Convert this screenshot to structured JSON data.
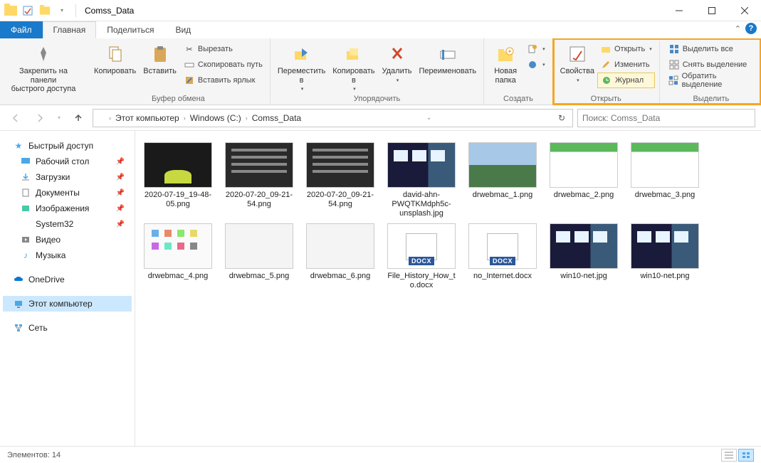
{
  "title": "Comss_Data",
  "tabs": {
    "file": "Файл",
    "home": "Главная",
    "share": "Поделиться",
    "view": "Вид"
  },
  "ribbon": {
    "pin": "Закрепить на панели\nбыстрого доступа",
    "copy": "Копировать",
    "paste": "Вставить",
    "cut": "Вырезать",
    "copy_path": "Скопировать путь",
    "paste_shortcut": "Вставить ярлык",
    "group_clipboard": "Буфер обмена",
    "move_to": "Переместить\nв",
    "copy_to": "Копировать\nв",
    "delete": "Удалить",
    "rename": "Переименовать",
    "group_organize": "Упорядочить",
    "new_folder": "Новая\nпапка",
    "group_new": "Создать",
    "properties": "Свойства",
    "open": "Открыть",
    "edit": "Изменить",
    "history": "Журнал",
    "group_open": "Открыть",
    "select_all": "Выделить все",
    "select_none": "Снять выделение",
    "invert": "Обратить выделение",
    "group_select": "Выделить"
  },
  "breadcrumb": {
    "pc": "Этот компьютер",
    "drive": "Windows (C:)",
    "folder": "Comss_Data"
  },
  "search": {
    "placeholder": "Поиск: Comss_Data"
  },
  "sidebar": {
    "quick": "Быстрый доступ",
    "desktop": "Рабочий стол",
    "downloads": "Загрузки",
    "documents": "Документы",
    "pictures": "Изображения",
    "system32": "System32",
    "videos": "Видео",
    "music": "Музыка",
    "onedrive": "OneDrive",
    "this_pc": "Этот компьютер",
    "network": "Сеть"
  },
  "files": [
    {
      "name": "2020-07-19_19-48-05.png",
      "thumb": "racing"
    },
    {
      "name": "2020-07-20_09-21-54.png",
      "thumb": "darklist"
    },
    {
      "name": "2020-07-20_09-21-54.png",
      "thumb": "darklist"
    },
    {
      "name": "david-ahn-PWQTKMdph5c-unsplash.jpg",
      "thumb": "dark-room"
    },
    {
      "name": "drwebmac_1.png",
      "thumb": "landscape"
    },
    {
      "name": "drwebmac_2.png",
      "thumb": "green"
    },
    {
      "name": "drwebmac_3.png",
      "thumb": "green"
    },
    {
      "name": "drwebmac_4.png",
      "thumb": "icons-grid"
    },
    {
      "name": "drwebmac_5.png",
      "thumb": "white"
    },
    {
      "name": "drwebmac_6.png",
      "thumb": "white"
    },
    {
      "name": "File_History_How_to.docx",
      "thumb": "docx"
    },
    {
      "name": "no_Internet.docx",
      "thumb": "docx"
    },
    {
      "name": "win10-net.jpg",
      "thumb": "dark-room"
    },
    {
      "name": "win10-net.png",
      "thumb": "dark-room"
    }
  ],
  "status": {
    "count_label": "Элементов:",
    "count": "14"
  }
}
